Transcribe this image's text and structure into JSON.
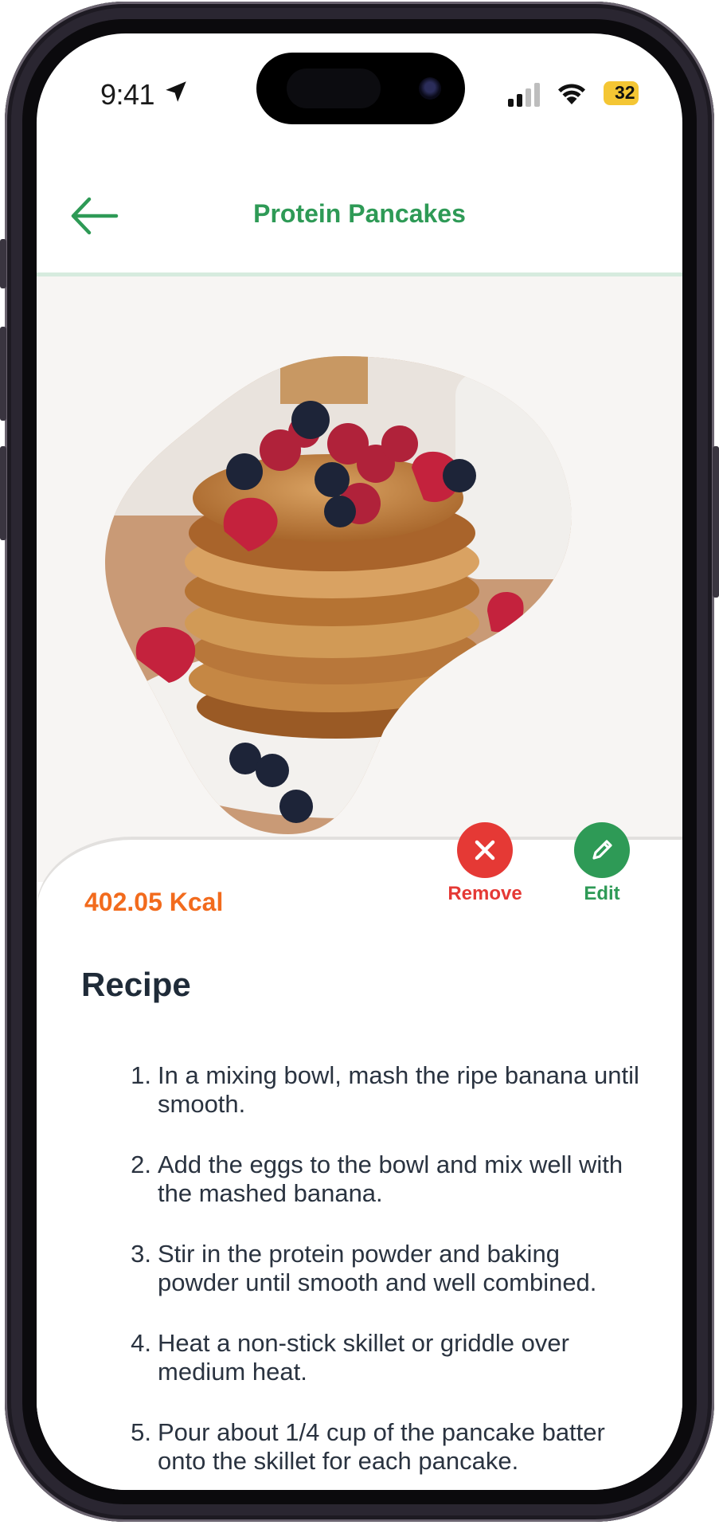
{
  "status_bar": {
    "time": "9:41",
    "battery": "32",
    "icons": [
      "location-arrow-icon",
      "cellular-signal-icon",
      "wifi-icon",
      "battery-icon"
    ]
  },
  "header": {
    "title": "Protein Pancakes",
    "back_icon": "arrow-left-icon"
  },
  "hero": {
    "image": "pancake-stack-with-berries"
  },
  "actions": {
    "remove_label": "Remove",
    "edit_label": "Edit"
  },
  "nutrition": {
    "calories": "402.05 Kcal"
  },
  "recipe": {
    "heading": "Recipe",
    "steps": [
      {
        "num": "1.",
        "text": "In a mixing bowl, mash the ripe banana until smooth."
      },
      {
        "num": "2.",
        "text": "Add the eggs to the bowl and mix well with the mashed banana."
      },
      {
        "num": "3.",
        "text": "Stir in the protein powder and baking powder until smooth and well combined."
      },
      {
        "num": "4.",
        "text": "Heat a non-stick skillet or griddle over medium heat."
      },
      {
        "num": "5.",
        "text": "Pour about 1/4 cup of the pancake batter onto the skillet for each pancake."
      }
    ]
  },
  "colors": {
    "brand_green": "#2e9a56",
    "remove_red": "#e53935",
    "kcal_orange": "#f26b1d",
    "battery_yellow": "#f4c634"
  }
}
